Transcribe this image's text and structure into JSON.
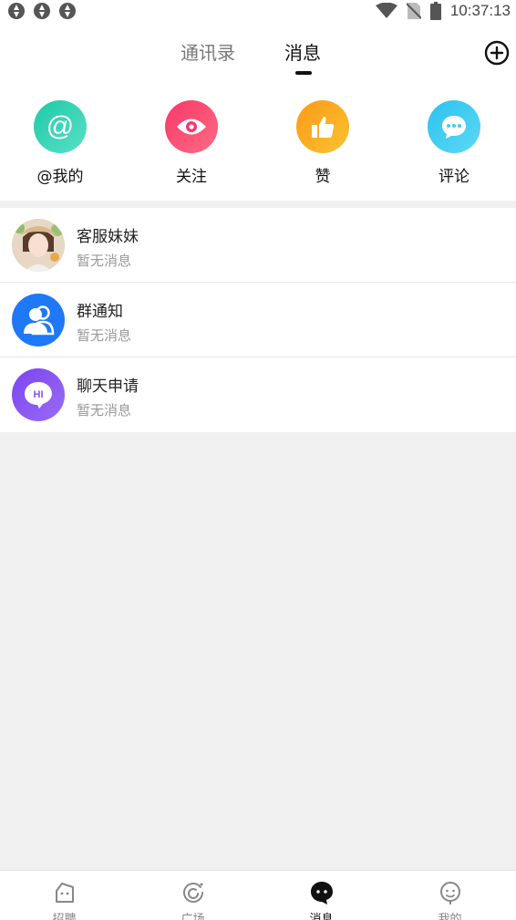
{
  "status_bar": {
    "time": "10:37:13"
  },
  "header": {
    "tabs": [
      {
        "label": "通讯录",
        "active": false
      },
      {
        "label": "消息",
        "active": true
      }
    ],
    "add_icon": "plus-circle-icon"
  },
  "quick_actions": [
    {
      "label": "@我的",
      "icon": "at-icon",
      "color": "#34d2b6"
    },
    {
      "label": "关注",
      "icon": "eye-icon",
      "color": "#fb4d73"
    },
    {
      "label": "赞",
      "icon": "thumbs-up-icon",
      "color": "#fbab21"
    },
    {
      "label": "评论",
      "icon": "comment-icon",
      "color": "#3ecbf0"
    }
  ],
  "conversations": [
    {
      "title": "客服妹妹",
      "preview": "暂无消息",
      "avatar": "photo-avatar"
    },
    {
      "title": "群通知",
      "preview": "暂无消息",
      "avatar": "group-icon",
      "color": "#1f78f5"
    },
    {
      "title": "聊天申请",
      "preview": "暂无消息",
      "avatar": "hi-chat-icon",
      "color": "#8353f3"
    }
  ],
  "bottom_nav": [
    {
      "label": "招聘",
      "icon": "recruit-icon",
      "active": false
    },
    {
      "label": "广场",
      "icon": "square-icon",
      "active": false
    },
    {
      "label": "消息",
      "icon": "message-icon",
      "active": true
    },
    {
      "label": "我的",
      "icon": "profile-icon",
      "active": false
    }
  ]
}
